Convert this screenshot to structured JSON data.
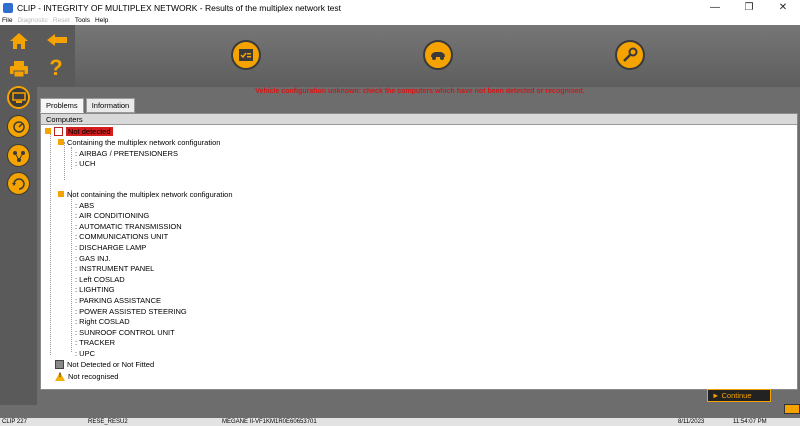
{
  "window": {
    "title": "CLIP - INTEGRITY OF MULTIPLEX NETWORK - Results of the multiplex network test",
    "minimize": "—",
    "restore": "❐",
    "close": "✕"
  },
  "menu": [
    {
      "label": "File",
      "enabled": true
    },
    {
      "label": "Diagnostic",
      "enabled": false
    },
    {
      "label": "Reset",
      "enabled": false
    },
    {
      "label": "Tools",
      "enabled": true
    },
    {
      "label": "Help",
      "enabled": true
    }
  ],
  "toolbar": {
    "help_label": "?"
  },
  "warning": "Vehicle configuration unknown: check the computers which have not been detected or recognised.",
  "tabs": [
    {
      "label": "Problems",
      "active": true
    },
    {
      "label": "Information",
      "active": false
    }
  ],
  "panel": {
    "header": "Computers"
  },
  "tree": {
    "not_detected": "Not detected",
    "containing_group": "Containing the multiplex network configuration",
    "containing_items": [
      "AIRBAG / PRETENSIONERS",
      "UCH"
    ],
    "not_containing_group": "Not containing the multiplex network configuration",
    "not_containing_items": [
      "ABS",
      "AIR CONDITIONING",
      "AUTOMATIC TRANSMISSION",
      "COMMUNICATIONS UNIT",
      "DISCHARGE LAMP",
      "GAS INJ.",
      "INSTRUMENT PANEL",
      "Left COSLAD",
      "LIGHTING",
      "PARKING ASSISTANCE",
      "POWER ASSISTED STEERING",
      "Right COSLAD",
      "SUNROOF CONTROL UNIT",
      "TRACKER",
      "UPC"
    ],
    "not_detected_or_fitted": "Not Detected or Not Fitted",
    "not_recognised": "Not recognised",
    "item_prefix": ": "
  },
  "continue_label": "► Continue",
  "status": {
    "clip": "CLIP 227",
    "rese": "RESE_RESU2",
    "vehicle": "MEGANE II-VF1KM1R0E60653701",
    "date": "8/11/2023",
    "time": "11:54:07 PM"
  },
  "colors": {
    "accent": "#f4a300",
    "warning_text": "#d01818",
    "highlight": "#d41e1e"
  }
}
